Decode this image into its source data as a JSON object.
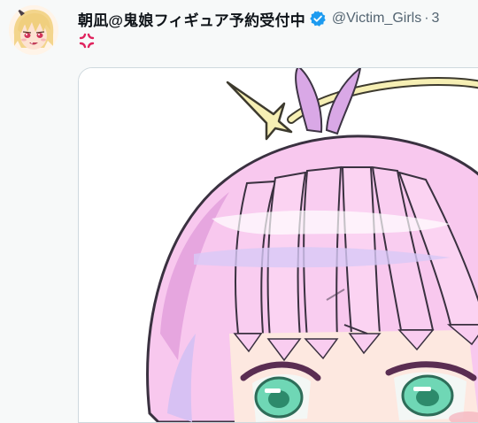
{
  "tweet": {
    "display_name": "朝凪@鬼娘フィギュア予約受付中",
    "handle": "@Victim_Girls",
    "separator": "·",
    "time": "3",
    "text_emoji": "anger-symbol-icon"
  },
  "colors": {
    "name": "#0f1419",
    "secondary": "#536471",
    "verified": "#1d9bf0",
    "anger": "#e0245e",
    "background": "#f7f9f9",
    "border": "#cfd9de"
  }
}
